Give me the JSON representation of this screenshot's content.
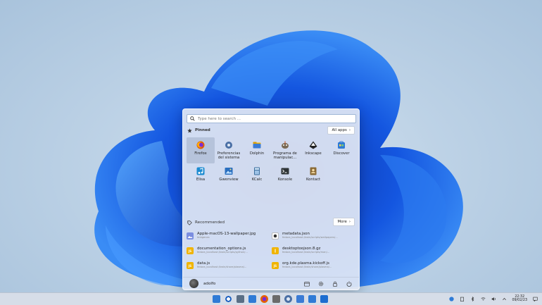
{
  "search": {
    "placeholder": "Type here to search ..."
  },
  "pinned": {
    "title": "Pinned",
    "all_apps_label": "All apps",
    "apps": [
      {
        "label": "Firefox",
        "icon": "firefox-icon",
        "color": "#e66000"
      },
      {
        "label": "Preferencias del sistema",
        "icon": "settings-icon",
        "color": "#4a6fa5"
      },
      {
        "label": "Dolphin",
        "icon": "folder-icon",
        "color": "#f2b300"
      },
      {
        "label": "Programa de manipulac...",
        "icon": "gimp-icon",
        "color": "#6b6b6b"
      },
      {
        "label": "Inkscape",
        "icon": "inkscape-icon",
        "color": "#222222"
      },
      {
        "label": "Discover",
        "icon": "discover-icon",
        "color": "#2f7bd6"
      },
      {
        "label": "Elisa",
        "icon": "music-icon",
        "color": "#1c8bd1"
      },
      {
        "label": "Gwenview",
        "icon": "image-viewer-icon",
        "color": "#2a6fbf"
      },
      {
        "label": "KCalc",
        "icon": "calculator-icon",
        "color": "#3d6f9e"
      },
      {
        "label": "Konsole",
        "icon": "terminal-icon",
        "color": "#2e3436"
      },
      {
        "label": "Kontact",
        "icon": "contacts-icon",
        "color": "#8a6a35"
      }
    ]
  },
  "recommended": {
    "title": "Recommended",
    "more_label": "More",
    "items": [
      {
        "name": "Apple-macOS-13-wallpaper.jpg",
        "path": "Imágenes",
        "icon": "image-file-icon",
        "color": "#7b8ee0",
        "badge": ""
      },
      {
        "name": "metadata.json",
        "path": "fedora_localhost:/kwin/scripts/wallpapers/...",
        "icon": "json-file-icon",
        "color": "#ffffff",
        "badge": ""
      },
      {
        "name": "documentation_options.js",
        "path": "fedora_localhost:/kwin/scripts/python/...",
        "icon": "js-file-icon",
        "color": "#f0b400",
        "badge": "JS"
      },
      {
        "name": "desktoptoojson.8.gz",
        "path": "fedora_localhost:/kwin/scripts/man/...",
        "icon": "archive-file-icon",
        "color": "#f0b400",
        "badge": ""
      },
      {
        "name": "data.js",
        "path": "fedora_localhost:/kwin/share/plasma/...",
        "icon": "js-file-icon",
        "color": "#f0b400",
        "badge": "JS"
      },
      {
        "name": "org.kde.plasma.kickoff.js",
        "path": "fedora_localhost:/kwin/share/plasma/...",
        "icon": "js-file-icon",
        "color": "#f0b400",
        "badge": "JS"
      }
    ]
  },
  "footer": {
    "username": "adolfo"
  },
  "taskbar": {
    "apps": [
      "start-icon",
      "search-icon",
      "settings-icon",
      "store-icon",
      "firefox-icon",
      "gimp-icon",
      "settings-icon",
      "folder-icon",
      "store-icon",
      "mail-icon"
    ],
    "time": "22:32",
    "date": "09/02/23"
  },
  "colors": {
    "accent": "#2f6fd6",
    "panel": "#e2e8f4"
  }
}
